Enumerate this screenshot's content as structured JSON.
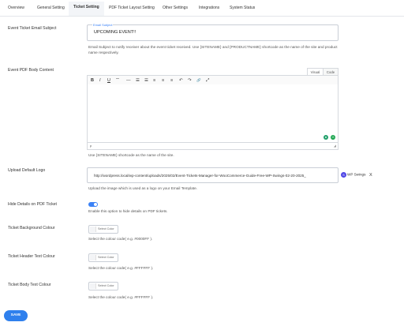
{
  "tabs": [
    "Overview",
    "General Setting",
    "Ticket Setting",
    "PDF Ticket Layout Setting",
    "Other Settings",
    "Integrations",
    "System Status"
  ],
  "email_subject": {
    "label": "Event Ticket Email Subject",
    "legend": "Email Subject",
    "value": "UPCOMING EVENT!!",
    "help": "Email Subject to notify receiver about the event ticket received. Use {SITENAME} and {PRODUCTNAME} shortcode as the name of the site and product name respectively."
  },
  "pdf_body": {
    "label": "Event PDF Body Content",
    "tab_visual": "Visual",
    "tab_code": "Code",
    "toolbar": [
      "B",
      "I",
      "U",
      "““",
      "—",
      "☰",
      "☰",
      "≡",
      "≡",
      "≡",
      "↶",
      "↷",
      "🔗",
      "⤢"
    ],
    "path": "p",
    "help": "Use {SITENAME} shortcode as the name of the site."
  },
  "logo": {
    "label": "Upload Default Logo",
    "url": "http://wordpress.local/wp-content/uploads/2025/02/Event-Tickets-Manager-for-WooCommerce-Guide-Free-WP-Swings-02-20-2025_",
    "logo_text": "WP Swings",
    "remove": "X",
    "help": "Upload the image which is used as a logo on your Email Template."
  },
  "hide_details": {
    "label": "Hide Details on PDF Ticket",
    "enabled": true,
    "help": "Enable this option to hide details on PDF tickets."
  },
  "ticket_bg": {
    "label": "Ticket Background Colour",
    "button": "Select Color",
    "help": "Select the colour code( e.g. #0000FF )."
  },
  "ticket_header": {
    "label": "Ticket Header Text Colour",
    "button": "Select Color",
    "help": "Select the colour code( e.g. #FFFFFF )."
  },
  "ticket_body": {
    "label": "Ticket Body Text Colour",
    "button": "Select Color",
    "help": "Select the colour code( e.g. #FFFFFF )."
  },
  "save_label": "SAVE",
  "colors": {
    "accent": "#2f80ed",
    "border": "#c9ced6"
  }
}
